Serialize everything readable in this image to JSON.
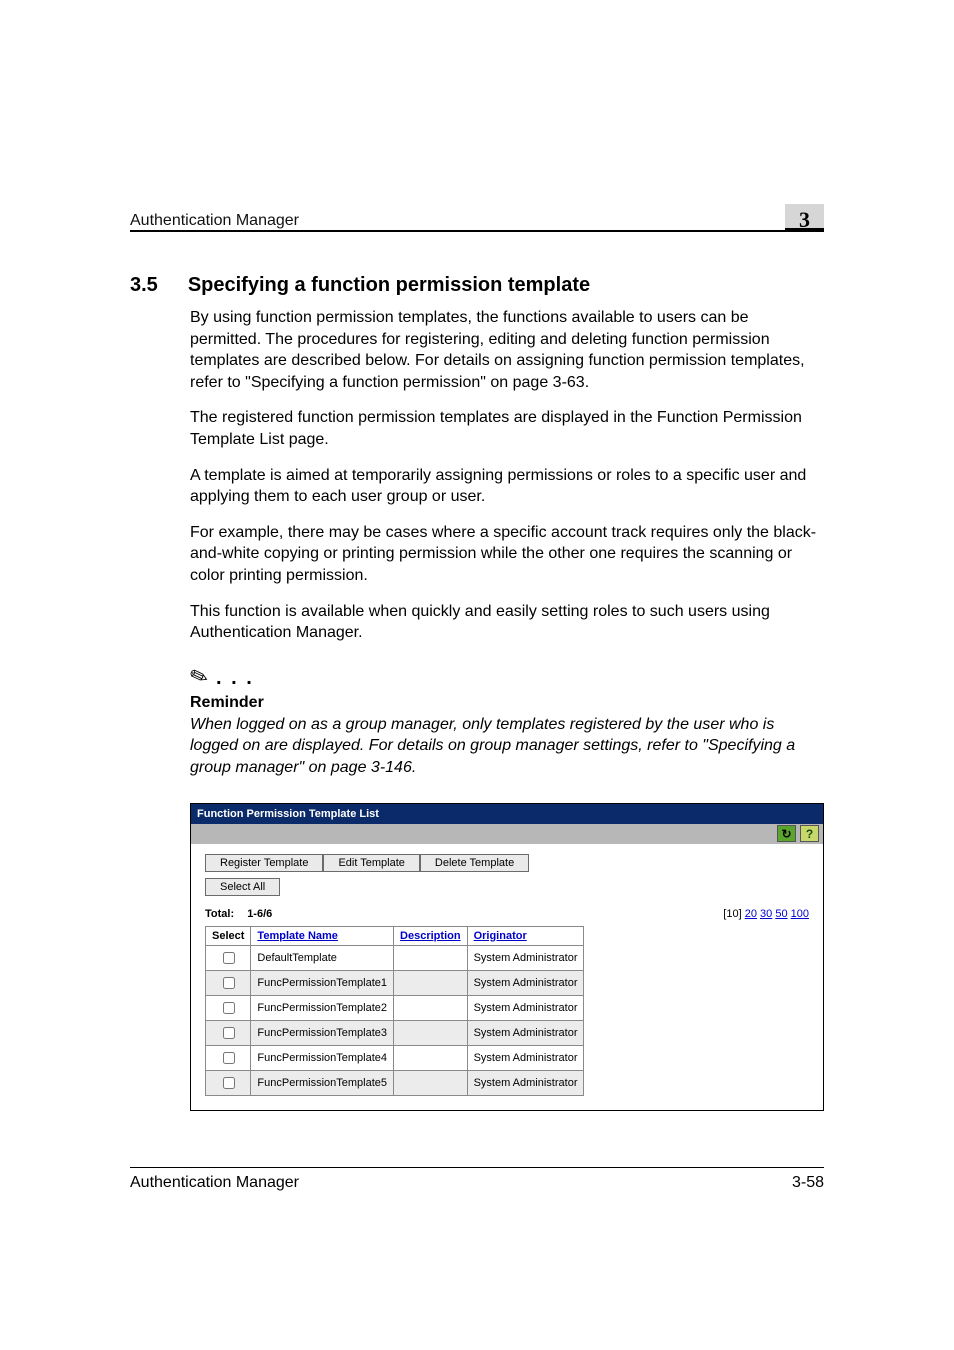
{
  "header": {
    "running_title": "Authentication Manager",
    "chapter_badge": "3"
  },
  "section": {
    "number": "3.5",
    "title": "Specifying a function permission template"
  },
  "paragraphs": {
    "p1": "By using function permission templates, the functions available to users can be permitted. The procedures for registering, editing and deleting function permission templates are described below. For details on assigning function permission templates, refer to \"Specifying a function permission\" on page 3-63.",
    "p2": "The registered function permission templates are displayed in the Function Permission Template List page.",
    "p3": "A template is aimed at temporarily assigning permissions or roles to a specific user and applying them to each user group or user.",
    "p4": "For example, there may be cases where a specific account track requires only the black-and-white copying or printing permission while the other one requires the scanning or color printing permission.",
    "p5": "This function is available when quickly and easily setting roles to such users using Authentication Manager."
  },
  "note": {
    "heading": "Reminder",
    "body": "When logged on as a group manager, only templates registered by the user who is logged on are displayed. For details on group manager settings, refer to \"Specifying a group manager\" on page 3-146."
  },
  "panel": {
    "title": "Function Permission Template List",
    "buttons": {
      "register": "Register Template",
      "edit": "Edit Template",
      "delete": "Delete Template",
      "select_all": "Select All"
    },
    "total_label": "Total:",
    "total_value": "1-6/6",
    "pager": {
      "current": "10",
      "options": [
        "20",
        "30",
        "50",
        "100"
      ]
    },
    "columns": {
      "select": "Select",
      "template_name": "Template Name",
      "description": "Description",
      "originator": "Originator"
    },
    "rows": [
      {
        "name": "DefaultTemplate",
        "description": "",
        "originator": "System Administrator"
      },
      {
        "name": "FuncPermissionTemplate1",
        "description": "",
        "originator": "System Administrator"
      },
      {
        "name": "FuncPermissionTemplate2",
        "description": "",
        "originator": "System Administrator"
      },
      {
        "name": "FuncPermissionTemplate3",
        "description": "",
        "originator": "System Administrator"
      },
      {
        "name": "FuncPermissionTemplate4",
        "description": "",
        "originator": "System Administrator"
      },
      {
        "name": "FuncPermissionTemplate5",
        "description": "",
        "originator": "System Administrator"
      }
    ]
  },
  "footer": {
    "title": "Authentication Manager",
    "page": "3-58"
  }
}
